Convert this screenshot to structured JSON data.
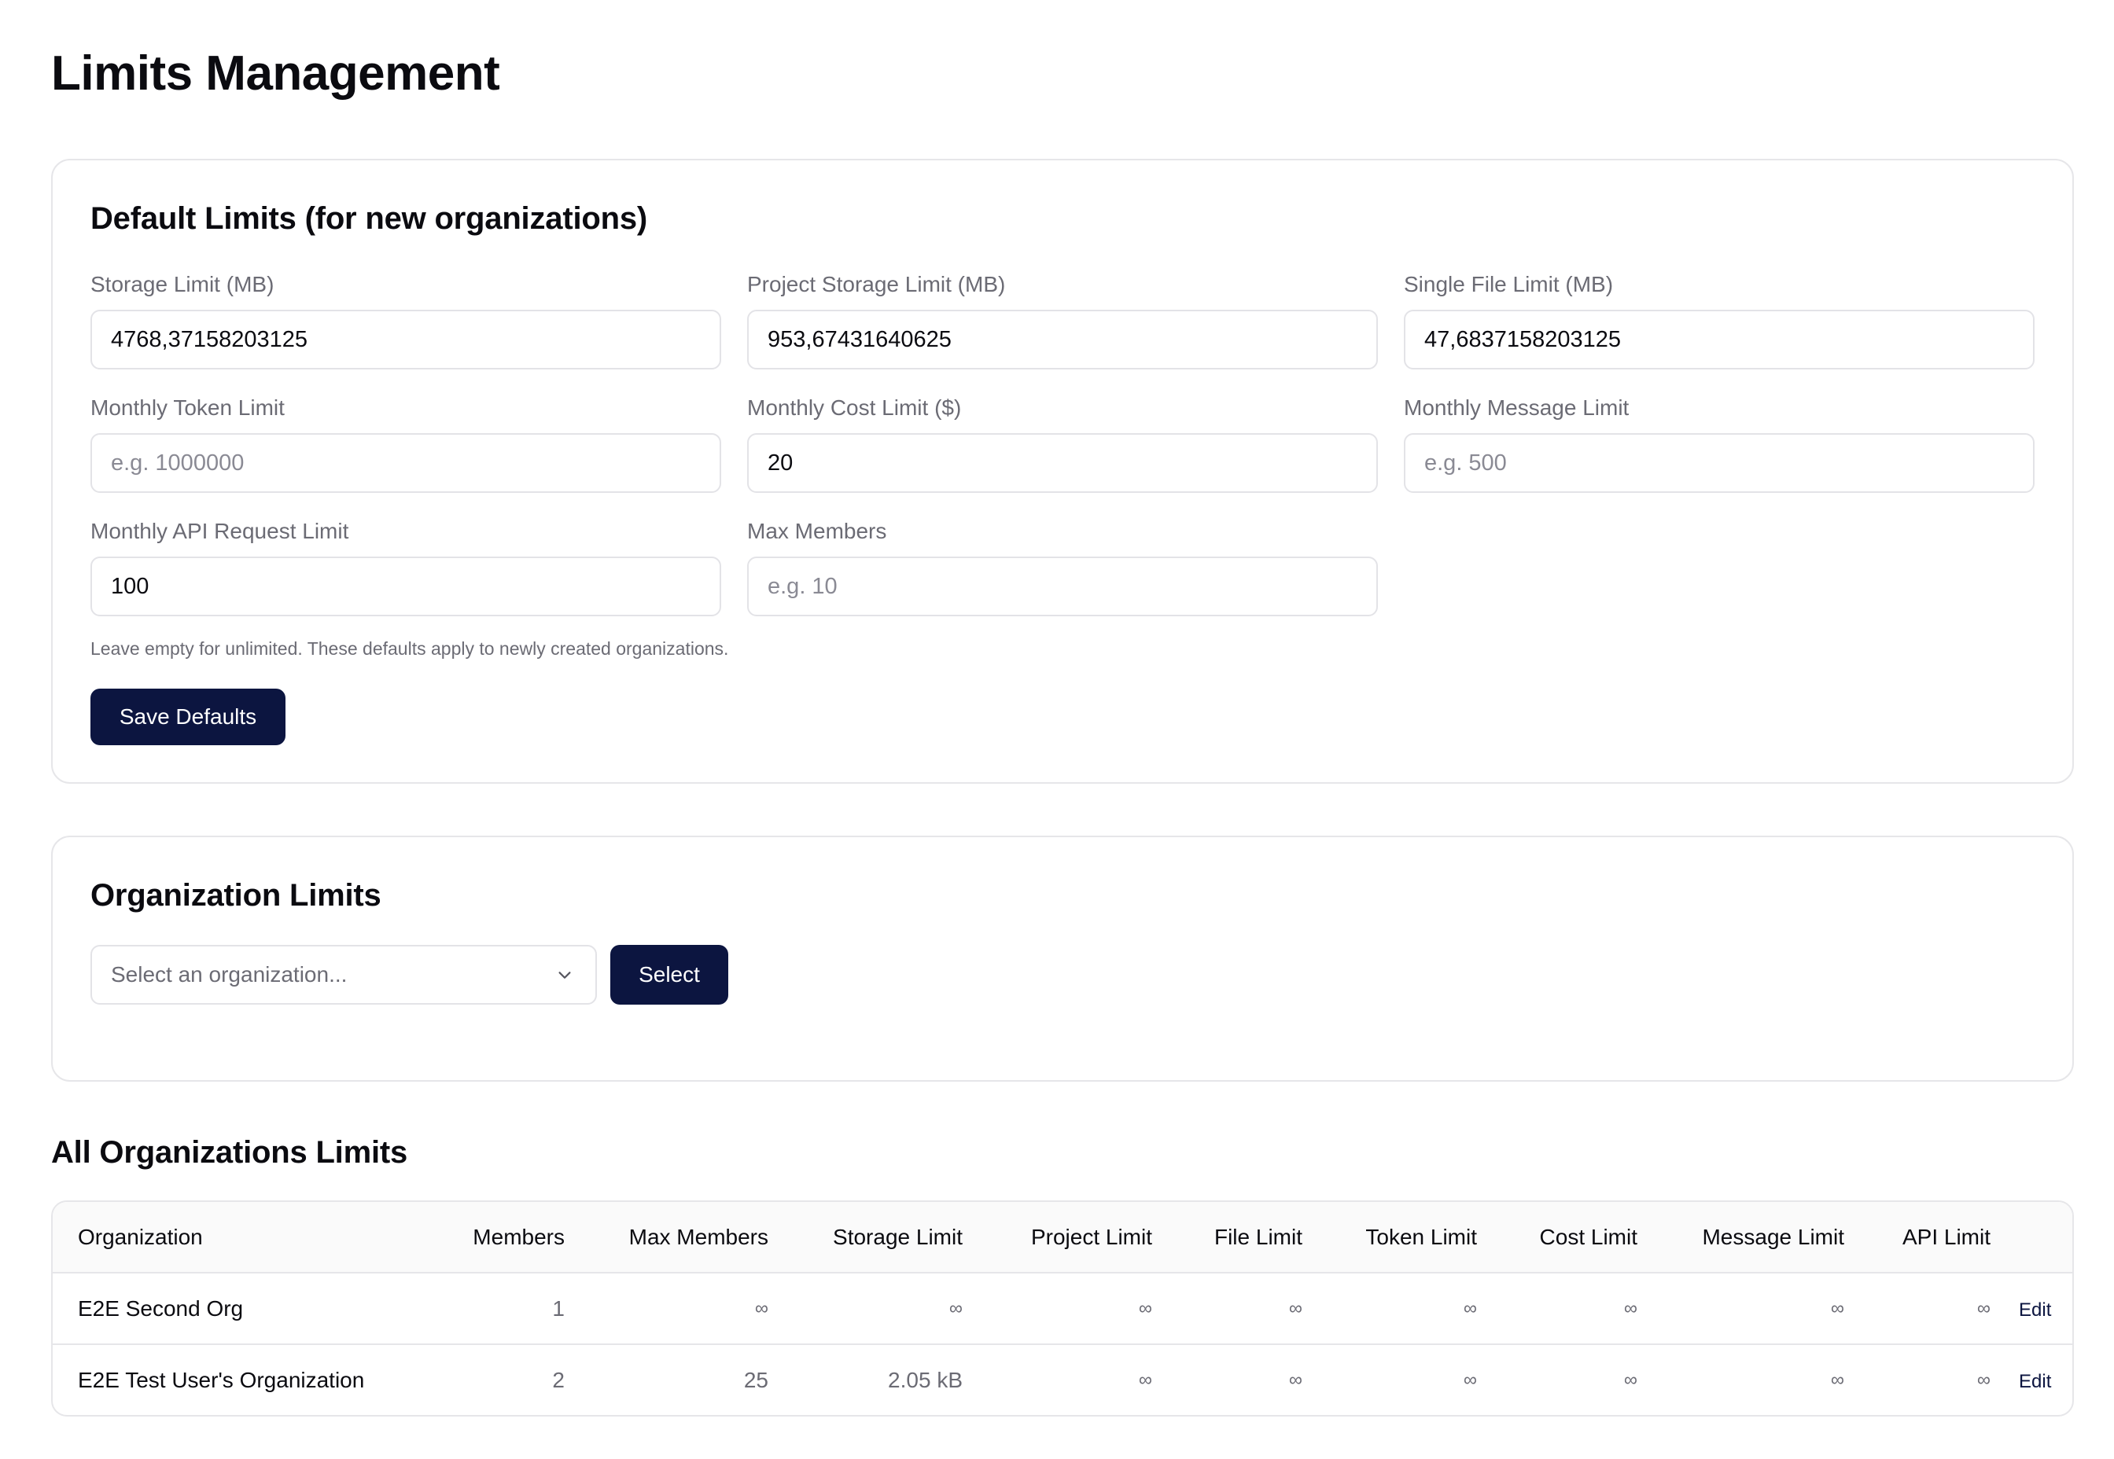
{
  "page": {
    "title": "Limits Management"
  },
  "defaults": {
    "title": "Default Limits (for new organizations)",
    "fields": [
      {
        "label": "Storage Limit (MB)",
        "value": "4768,37158203125",
        "placeholder": ""
      },
      {
        "label": "Project Storage Limit (MB)",
        "value": "953,67431640625",
        "placeholder": ""
      },
      {
        "label": "Single File Limit (MB)",
        "value": "47,6837158203125",
        "placeholder": ""
      },
      {
        "label": "Monthly Token Limit",
        "value": "",
        "placeholder": "e.g. 1000000"
      },
      {
        "label": "Monthly Cost Limit ($)",
        "value": "20",
        "placeholder": ""
      },
      {
        "label": "Monthly Message Limit",
        "value": "",
        "placeholder": "e.g. 500"
      },
      {
        "label": "Monthly API Request Limit",
        "value": "100",
        "placeholder": ""
      },
      {
        "label": "Max Members",
        "value": "",
        "placeholder": "e.g. 10"
      }
    ],
    "hint": "Leave empty for unlimited. These defaults apply to newly created organizations.",
    "save_label": "Save Defaults"
  },
  "org_limits": {
    "title": "Organization Limits",
    "select_placeholder": "Select an organization...",
    "select_button": "Select"
  },
  "all_limits": {
    "title": "All Organizations Limits",
    "columns": [
      "Organization",
      "Members",
      "Max Members",
      "Storage Limit",
      "Project Limit",
      "File Limit",
      "Token Limit",
      "Cost Limit",
      "Message Limit",
      "API Limit",
      ""
    ],
    "rows": [
      {
        "organization": "E2E Second Org",
        "members": "1",
        "max_members": "∞",
        "storage": "∞",
        "project": "∞",
        "file": "∞",
        "token": "∞",
        "cost": "∞",
        "message": "∞",
        "api": "∞",
        "action": "Edit"
      },
      {
        "organization": "E2E Test User's Organization",
        "members": "2",
        "max_members": "25",
        "storage": "2.05 kB",
        "project": "∞",
        "file": "∞",
        "token": "∞",
        "cost": "∞",
        "message": "∞",
        "api": "∞",
        "action": "Edit"
      }
    ]
  },
  "colors": {
    "primary": "#0c1540",
    "border": "#e6e6e9",
    "muted": "#6b6b74"
  },
  "icons": {
    "select_chevron": "chevron-down-icon"
  }
}
